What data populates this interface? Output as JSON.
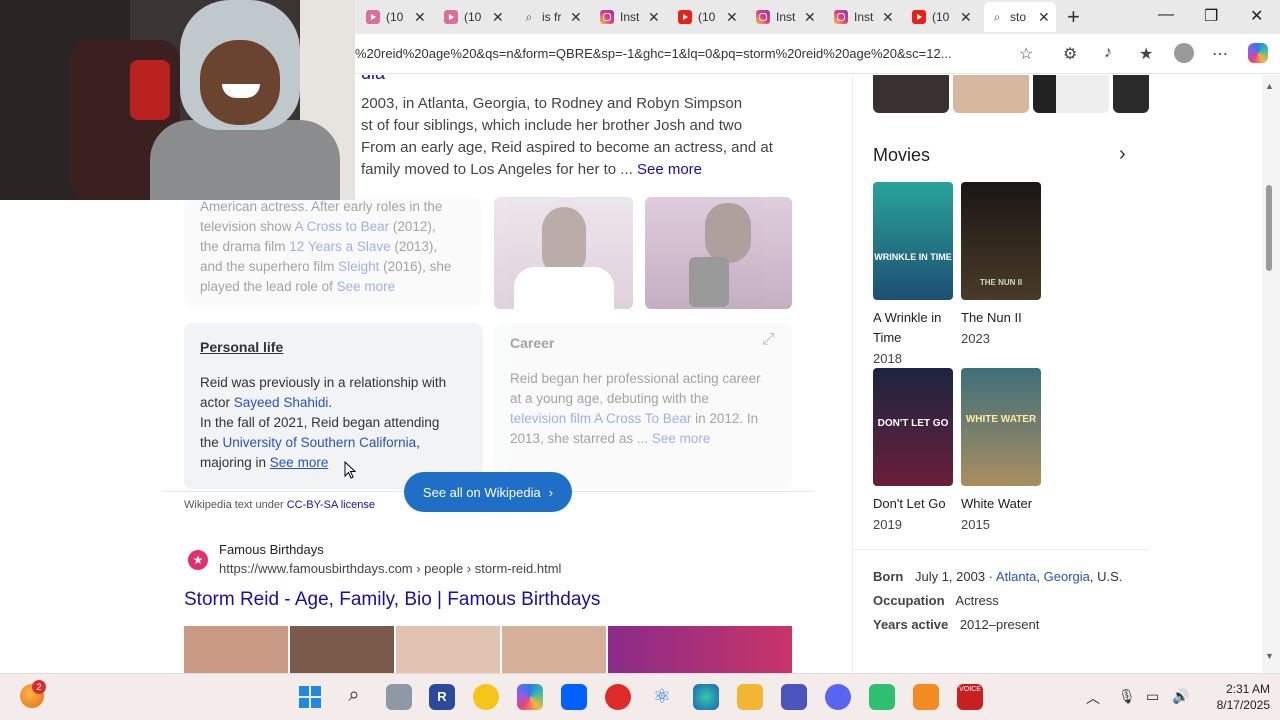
{
  "tabs": [
    {
      "title": "(10",
      "icon": "youtube-pink-icon"
    },
    {
      "title": "(10",
      "icon": "youtube-pink-icon"
    },
    {
      "title": "is fr",
      "icon": "search-icon"
    },
    {
      "title": "Inst",
      "icon": "instagram-icon"
    },
    {
      "title": "(10",
      "icon": "youtube-icon"
    },
    {
      "title": "Inst",
      "icon": "instagram-icon"
    },
    {
      "title": "Inst",
      "icon": "instagram-icon"
    },
    {
      "title": "(10",
      "icon": "youtube-icon"
    },
    {
      "title": "sto",
      "icon": "search-icon"
    }
  ],
  "address_bar": {
    "url": "%20reid%20age%20&qs=n&form=QBRE&sp=-1&ghc=1&lq=0&pq=storm%20reid%20age%20&sc=12..."
  },
  "intro": {
    "heading_fragment": "dia",
    "line1": "2003, in Atlanta, Georgia, to Rodney and Robyn Simpson",
    "line2": "st of four siblings, which include her brother Josh and two",
    "line3": "From an early age, Reid aspired to become an actress, and at",
    "line4a": "family moved to Los Angeles for her to ...",
    "see_more": "See more"
  },
  "bio_card": {
    "line1": "American actress. After early roles in the",
    "line2a": "television show",
    "link1": "A Cross to Bear",
    "line2b": "(2012),",
    "line3a": "the drama film",
    "link2": "12 Years a Slave",
    "line3b": "(2013),",
    "line4a": "and the superhero film",
    "link3": "Sleight",
    "line4b": "(2016), she",
    "line5a": "played the lead role of",
    "see_more": "See more"
  },
  "personal_life": {
    "title": "Personal life",
    "line1": "Reid was previously in a relationship with",
    "line2a": "actor",
    "link1": "Sayeed Shahidi",
    "line3": "In the fall of 2021, Reid began attending",
    "line4a": "the",
    "link2": "University of Southern California",
    "line5a": "majoring in",
    "see_more": "See more"
  },
  "career": {
    "title": "Career",
    "line1": "Reid began her professional acting career",
    "line2": "at a young age, debuting with the",
    "link1": "television film A Cross To Bear",
    "line3b": "in 2012. In",
    "line4a": "2013, she starred as ...",
    "see_more": "See more"
  },
  "wikipedia": {
    "button_label": "See all on Wikipedia",
    "license_prefix": "Wikipedia text under",
    "license_link": "CC-BY-SA license"
  },
  "result": {
    "site_name": "Famous Birthdays",
    "url": "https://www.famousbirthdays.com › people › storm-reid.html",
    "title": "Storm Reid - Age, Family, Bio | Famous Birthdays"
  },
  "movies": {
    "title": "Movies",
    "items": [
      {
        "title_line1": "A Wrinkle in",
        "title_line2": "Time",
        "year": "2018",
        "poster_text": "WRINKLE IN TIME"
      },
      {
        "title_line1": "The Nun II",
        "title_line2": "",
        "year": "2023",
        "poster_text": "THE NUN II"
      },
      {
        "title_line1": "Don't Let Go",
        "title_line2": "",
        "year": "2019",
        "poster_text": "DON'T LET GO"
      },
      {
        "title_line1": "White Water",
        "title_line2": "",
        "year": "2015",
        "poster_text": "WHITE WATER"
      }
    ]
  },
  "facts": {
    "born_label": "Born",
    "born_value": "July 1, 2003 ·",
    "born_city": "Atlanta",
    "born_state": "Georgia",
    "born_country": ", U.S.",
    "occupation_label": "Occupation",
    "occupation_value": "Actress",
    "years_label": "Years active",
    "years_value": "2012–present"
  },
  "taskbar": {
    "weather_badge": "2",
    "time": "2:31 AM",
    "date": "8/17/2025"
  },
  "colors": {
    "link": "#1a0dab",
    "wiki_button": "#1f6fc6",
    "accent_pink": "#e1306c"
  }
}
